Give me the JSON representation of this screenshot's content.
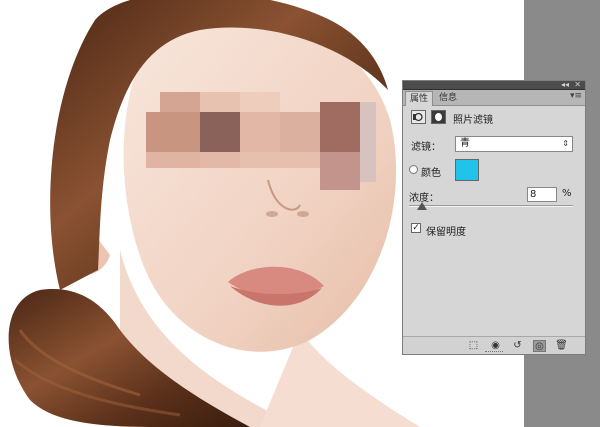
{
  "panel": {
    "tabs": [
      {
        "label": "属性",
        "active": true
      },
      {
        "label": "信息",
        "active": false
      }
    ],
    "collapse_icon": "double-arrow-left-icon",
    "close_icon": "close-icon",
    "menu_icon": "panel-menu-icon",
    "adjustment_title": "照片滤镜",
    "filter": {
      "label": "滤镜：",
      "value": "青"
    },
    "color": {
      "label": "颜色",
      "swatch": "#22c3eb"
    },
    "density": {
      "label": "浓度：",
      "value": "8",
      "unit": "%",
      "level_percent": 8
    },
    "preserve_luminosity": {
      "label": "保留明度",
      "checked": true
    },
    "bottom_icons": [
      "clip-to-layer-icon",
      "view-previous-icon",
      "reset-icon",
      "visibility-icon",
      "trash-icon"
    ]
  },
  "colors": {
    "workspace": "#8a8a8a",
    "panel_bg": "#d6d6d6",
    "hair": "#6e3f22",
    "skin": "#f3d7c8"
  }
}
